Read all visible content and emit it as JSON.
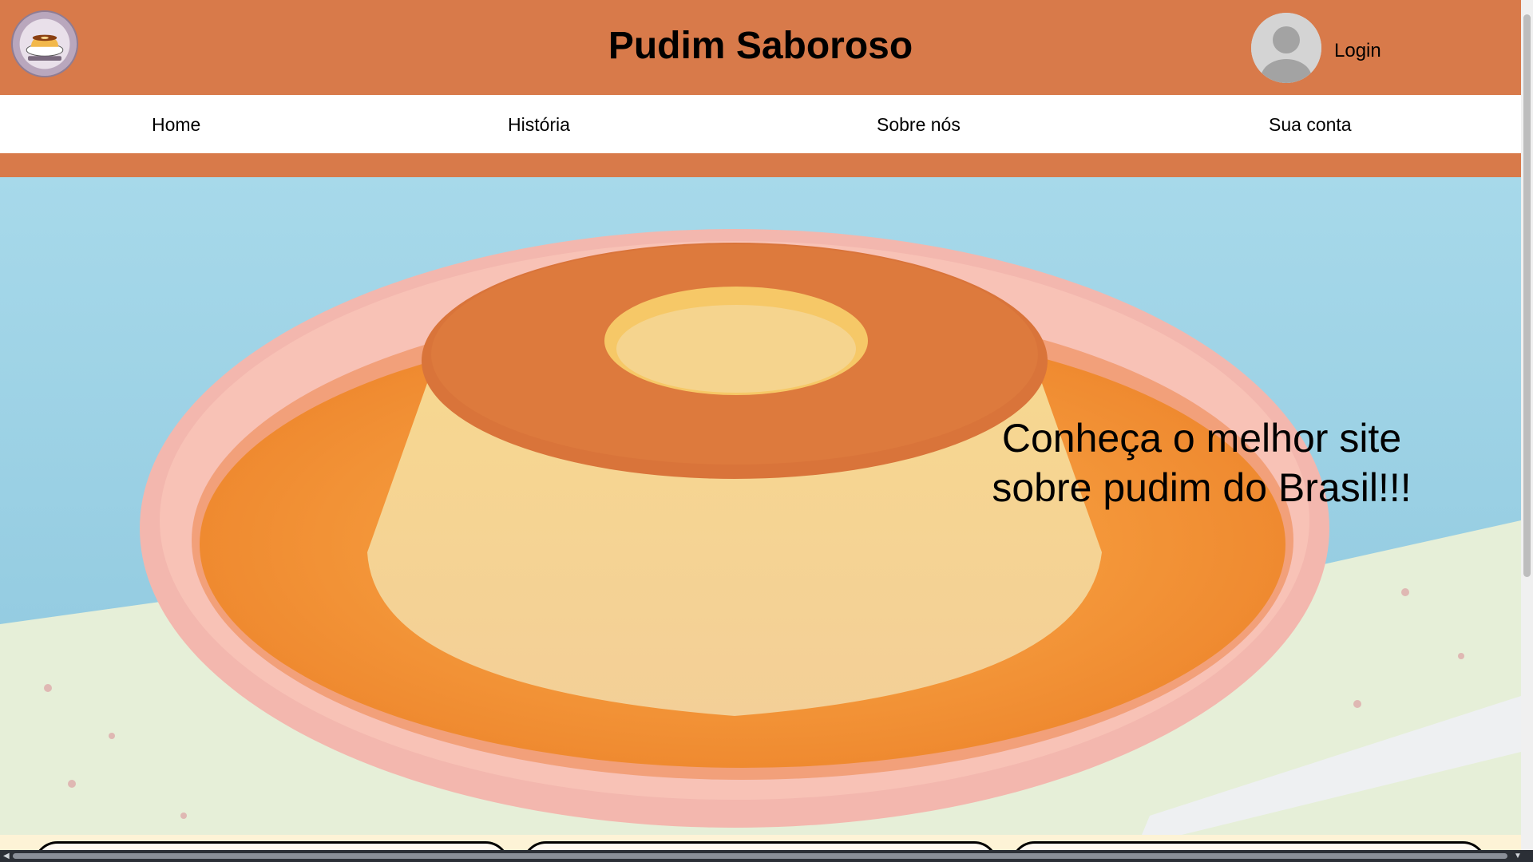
{
  "header": {
    "title": "Pudim Saboroso",
    "login_label": "Login",
    "logo_icon": "pudim-logo-icon",
    "avatar_icon": "user-avatar-icon"
  },
  "nav": {
    "items": [
      {
        "label": "Home"
      },
      {
        "label": "História"
      },
      {
        "label": "Sobre nós"
      },
      {
        "label": "Sua conta"
      }
    ]
  },
  "hero": {
    "tagline_line1": "Conheça o melhor site",
    "tagline_line2": "sobre pudim do Brasil!!!"
  },
  "colors": {
    "brand": "#d87a4a",
    "nav_bg": "#ffffff",
    "page_bg": "#fdf3d6"
  }
}
